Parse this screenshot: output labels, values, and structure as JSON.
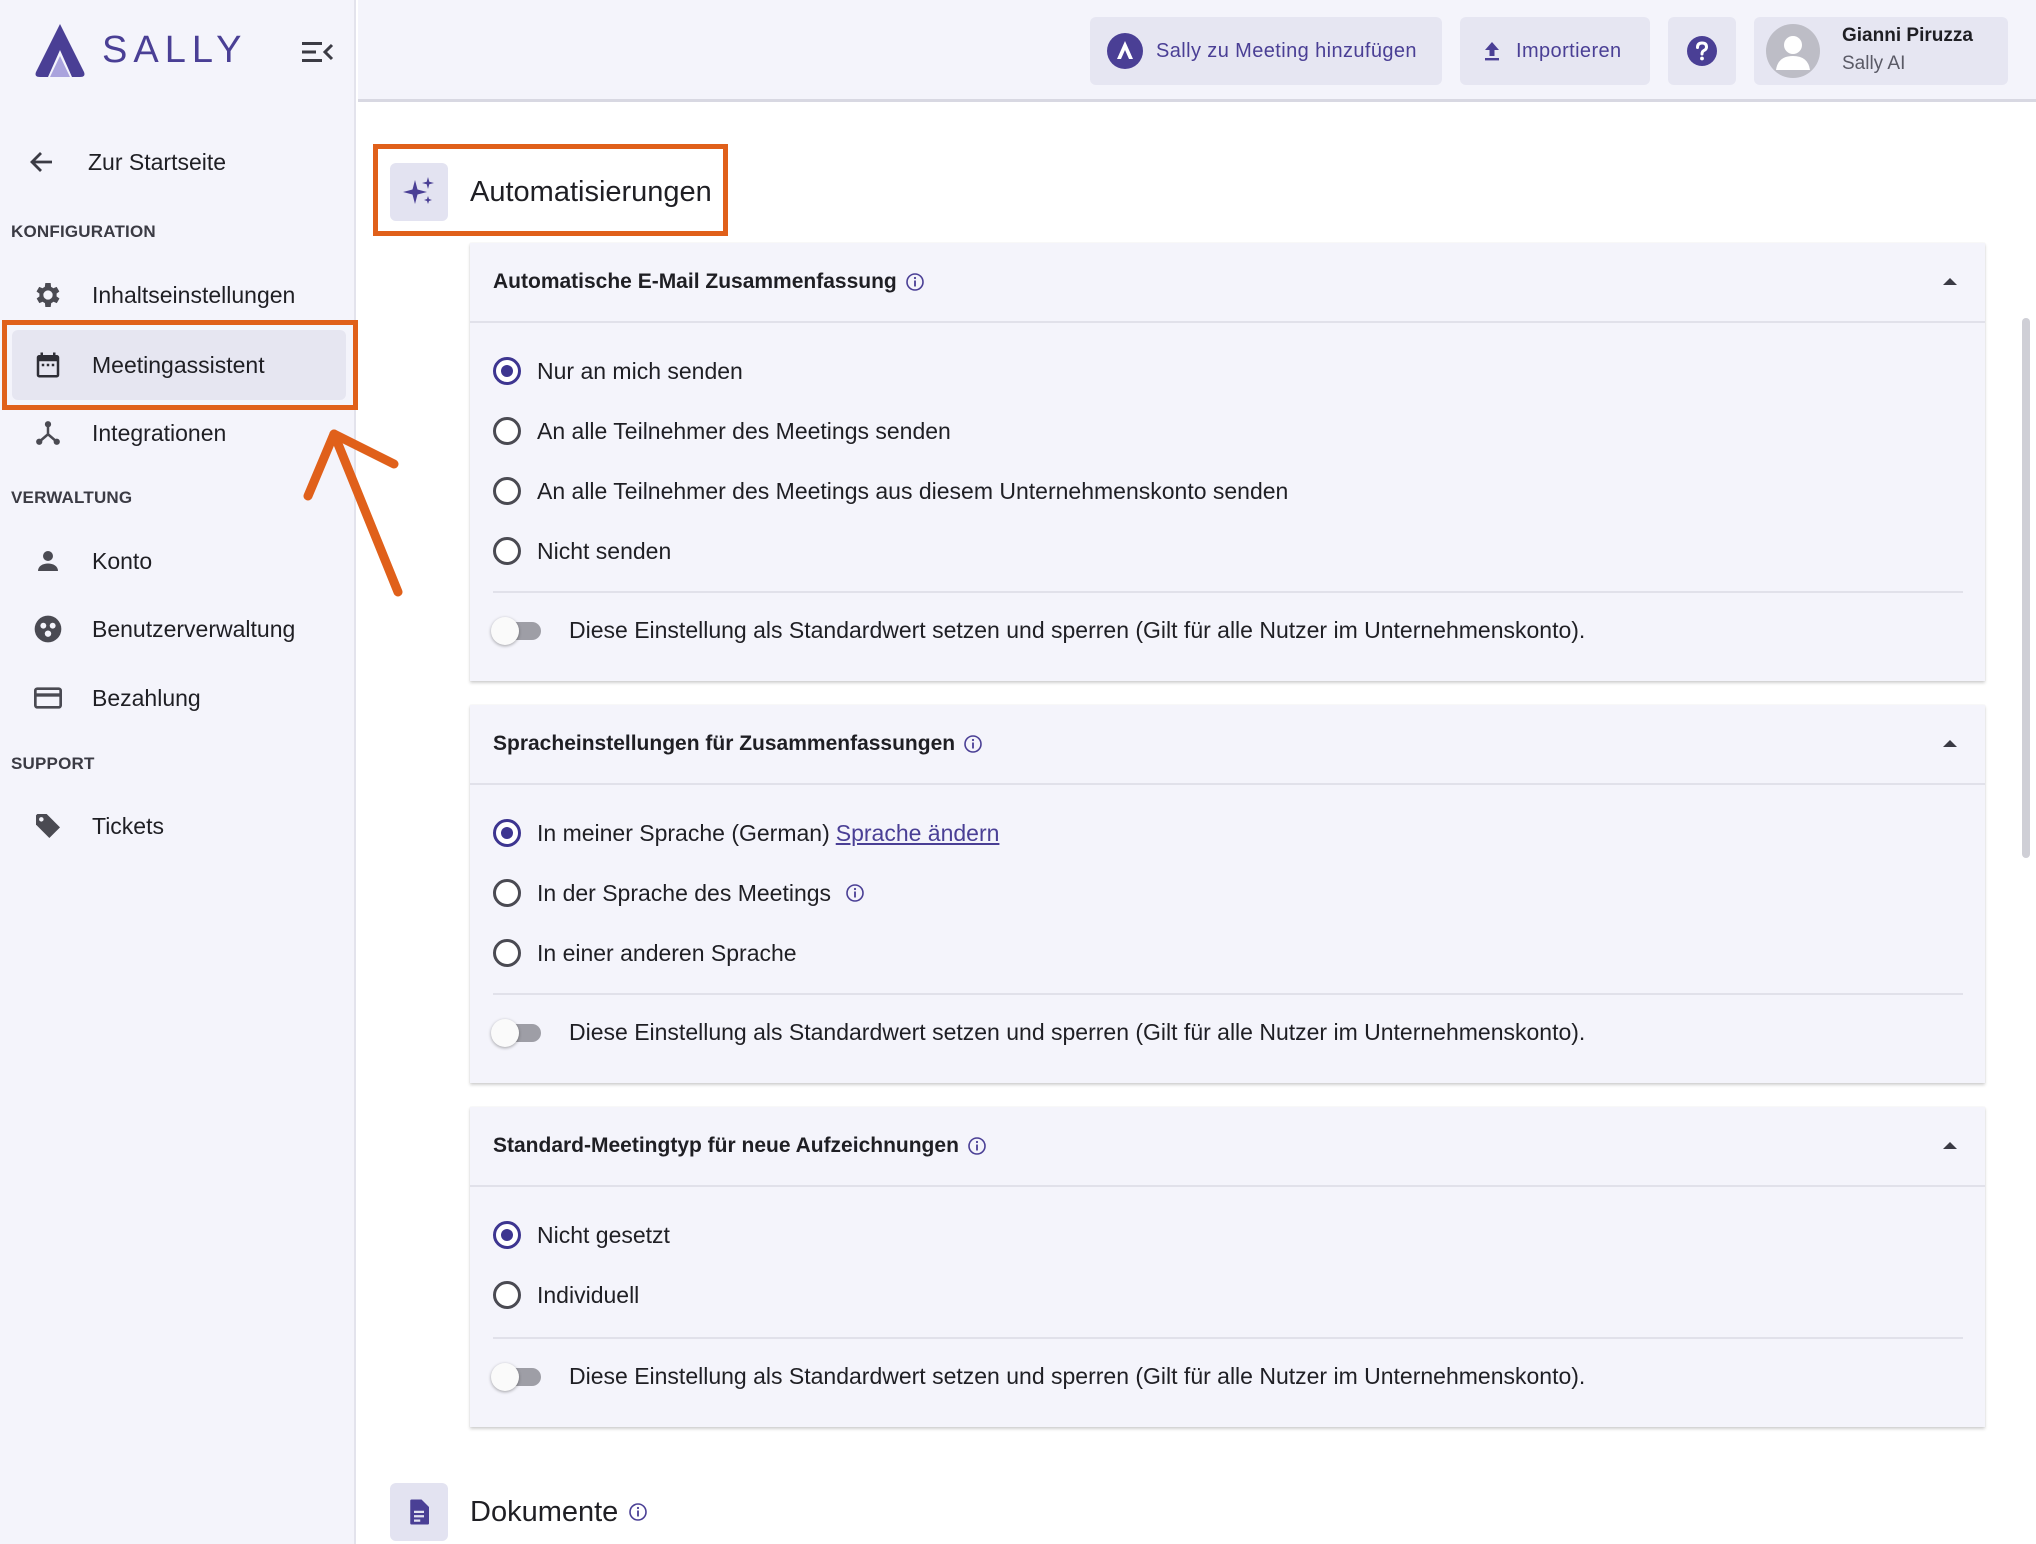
{
  "app": {
    "brand_name": "SALLY",
    "accent_color": "#4a3f95",
    "highlight_color": "#e0601a"
  },
  "sidebar": {
    "back_label": "Zur Startseite",
    "sections": [
      {
        "title": "KONFIGURATION"
      },
      {
        "title": "VERWALTUNG"
      },
      {
        "title": "SUPPORT"
      }
    ],
    "items": [
      {
        "label": "Inhaltseinstellungen",
        "icon": "gear-icon"
      },
      {
        "label": "Meetingassistent",
        "icon": "calendar-icon",
        "active": true
      },
      {
        "label": "Integrationen",
        "icon": "integration-icon"
      },
      {
        "label": "Konto",
        "icon": "person-icon"
      },
      {
        "label": "Benutzerverwaltung",
        "icon": "users-icon"
      },
      {
        "label": "Bezahlung",
        "icon": "credit-card-icon"
      },
      {
        "label": "Tickets",
        "icon": "tag-icon"
      }
    ]
  },
  "topbar": {
    "add_to_meeting_label": "Sally zu Meeting hinzufügen",
    "import_label": "Importieren",
    "help_icon": "help-icon",
    "user_name": "Gianni Piruzza",
    "user_org": "Sally AI"
  },
  "main": {
    "section_title": "Automatisierungen",
    "cards": [
      {
        "title": "Automatische E-Mail Zusammenfassung",
        "options": [
          {
            "label": "Nur an mich senden",
            "selected": true
          },
          {
            "label": "An alle Teilnehmer des Meetings senden",
            "selected": false
          },
          {
            "label": "An alle Teilnehmer des Meetings aus diesem Unternehmenskonto senden",
            "selected": false
          },
          {
            "label": "Nicht senden",
            "selected": false
          }
        ],
        "toggle_label": "Diese Einstellung als Standardwert setzen und sperren (Gilt für alle Nutzer im Unternehmenskonto).",
        "toggle_on": false
      },
      {
        "title": "Spracheinstellungen für Zusammenfassungen",
        "options": [
          {
            "label": "In meiner Sprache (German)",
            "link": "Sprache ändern",
            "selected": true
          },
          {
            "label": "In der Sprache des Meetings",
            "info": true,
            "selected": false
          },
          {
            "label": "In einer anderen Sprache",
            "selected": false
          }
        ],
        "toggle_label": "Diese Einstellung als Standardwert setzen und sperren (Gilt für alle Nutzer im Unternehmenskonto).",
        "toggle_on": false
      },
      {
        "title": "Standard-Meetingtyp für neue Aufzeichnungen",
        "options": [
          {
            "label": "Nicht gesetzt",
            "selected": true
          },
          {
            "label": "Individuell",
            "selected": false
          }
        ],
        "toggle_label": "Diese Einstellung als Standardwert setzen und sperren (Gilt für alle Nutzer im Unternehmenskonto).",
        "toggle_on": false
      }
    ],
    "next_section_title": "Dokumente"
  }
}
